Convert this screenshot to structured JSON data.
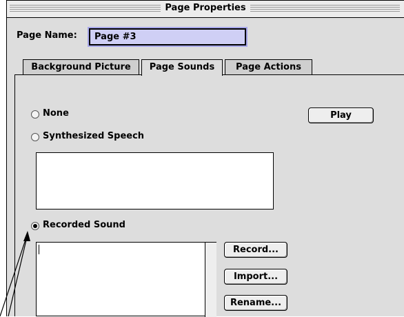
{
  "dialog": {
    "title": "Page Properties"
  },
  "page_name": {
    "label": "Page Name:",
    "value": "Page #3"
  },
  "tabs": [
    {
      "label": "Background Picture",
      "selected": false
    },
    {
      "label": "Page Sounds",
      "selected": true
    },
    {
      "label": "Page Actions",
      "selected": false
    }
  ],
  "sound_options": {
    "none_label": "None",
    "speech_label": "Synthesized Speech",
    "recorded_label": "Recorded Sound",
    "selected": "Recorded Sound"
  },
  "buttons": {
    "play": "Play",
    "record": "Record...",
    "import": "Import...",
    "rename": "Rename..."
  },
  "colors": {
    "dialog_bg": "#dddddd",
    "field_highlight": "#cfcff5"
  }
}
